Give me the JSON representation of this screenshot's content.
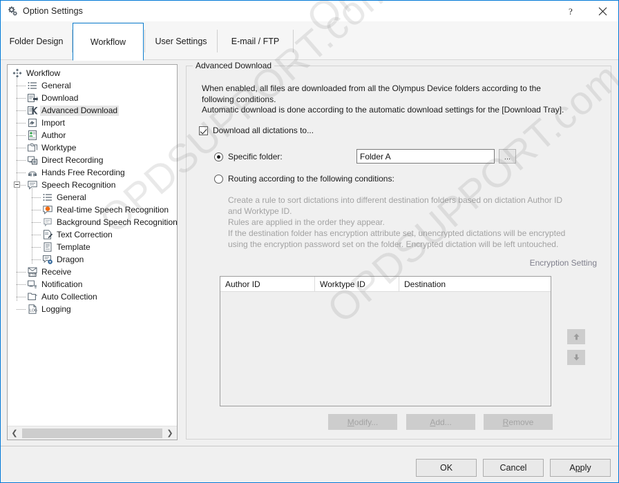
{
  "window": {
    "title": "Option Settings",
    "icon": "gear-icon",
    "help_label": "?",
    "close_label": "✕"
  },
  "tabs": [
    {
      "label": "Folder Design",
      "selected": false
    },
    {
      "label": "Workflow",
      "selected": true
    },
    {
      "label": "User Settings",
      "selected": false
    },
    {
      "label": "E-mail / FTP",
      "selected": false
    }
  ],
  "tree": {
    "items": [
      {
        "label": "Workflow",
        "icon": "workflow-icon",
        "depth": 0,
        "selected": false
      },
      {
        "label": "General",
        "icon": "list-icon",
        "depth": 1,
        "selected": false
      },
      {
        "label": "Download",
        "icon": "download-icon",
        "depth": 1,
        "selected": false
      },
      {
        "label": "Advanced Download",
        "icon": "advanced-download-icon",
        "depth": 1,
        "selected": true
      },
      {
        "label": "Import",
        "icon": "import-icon",
        "depth": 1,
        "selected": false
      },
      {
        "label": "Author",
        "icon": "author-icon",
        "depth": 1,
        "selected": false
      },
      {
        "label": "Worktype",
        "icon": "worktype-icon",
        "depth": 1,
        "selected": false
      },
      {
        "label": "Direct Recording",
        "icon": "direct-recording-icon",
        "depth": 1,
        "selected": false
      },
      {
        "label": "Hands Free Recording",
        "icon": "hands-free-icon",
        "depth": 1,
        "selected": false
      },
      {
        "label": "Speech Recognition",
        "icon": "speech-recognition-icon",
        "depth": 1,
        "selected": false,
        "expander": "collapse"
      },
      {
        "label": "General",
        "icon": "list-icon",
        "depth": 2,
        "selected": false
      },
      {
        "label": "Real-time Speech Recognition",
        "icon": "realtime-speech-icon",
        "depth": 2,
        "selected": false
      },
      {
        "label": "Background Speech Recognition",
        "icon": "background-speech-icon",
        "depth": 2,
        "selected": false
      },
      {
        "label": "Text Correction",
        "icon": "text-correction-icon",
        "depth": 2,
        "selected": false
      },
      {
        "label": "Template",
        "icon": "template-icon",
        "depth": 2,
        "selected": false
      },
      {
        "label": "Dragon",
        "icon": "dragon-icon",
        "depth": 2,
        "selected": false
      },
      {
        "label": "Receive",
        "icon": "receive-ftp-icon",
        "depth": 1,
        "selected": false
      },
      {
        "label": "Notification",
        "icon": "notification-icon",
        "depth": 1,
        "selected": false
      },
      {
        "label": "Auto Collection",
        "icon": "auto-collection-icon",
        "depth": 1,
        "selected": false
      },
      {
        "label": "Logging",
        "icon": "logging-icon",
        "depth": 1,
        "selected": false
      }
    ]
  },
  "panel": {
    "group_title": "Advanced Download",
    "description": "When enabled, all files are downloaded from all the Olympus Device folders according to the\nfollowing conditions.\nAutomatic download is done according to the automatic download settings for the [Download Tray].",
    "download_all_label": "Download all dictations to...",
    "download_all_checked": true,
    "specific_folder_label": "Specific folder:",
    "specific_folder_selected": true,
    "folder_value": "Folder A",
    "folder_placeholder": "",
    "browse_label": "...",
    "routing_label": "Routing according to the following conditions:",
    "routing_selected": false,
    "routing_description": "Create a rule to sort dictations into different destination folders based on dictation Author ID\nand Worktype ID.\nRules are applied in the order they appear.\nIf the destination folder has encryption attribute set, unencrypted dictations will be encrypted\nusing the encryption password set on the folder. Encrypted dictation will be left untouched.",
    "encryption_setting_label": "Encryption Setting",
    "table": {
      "columns": [
        "Author ID",
        "Worktype ID",
        "Destination"
      ],
      "rows": []
    },
    "move_up_label": "▲",
    "move_down_label": "▼",
    "modify_label": "Modify...",
    "add_label": "Add...",
    "remove_label": "Remove"
  },
  "footer": {
    "ok_label": "OK",
    "cancel_label": "Cancel",
    "apply_label": "Apply"
  },
  "watermark": {
    "lines": [
      "OPDSUPPORT.com",
      "OPDSUPPORT.com",
      "OPDSUPPORT.com"
    ]
  },
  "colors": {
    "accent": "#0078d7",
    "tab_selected_border": "#0c7ccd",
    "window_bg": "#f0f0f0",
    "disabled_text": "#a3a3a3"
  }
}
